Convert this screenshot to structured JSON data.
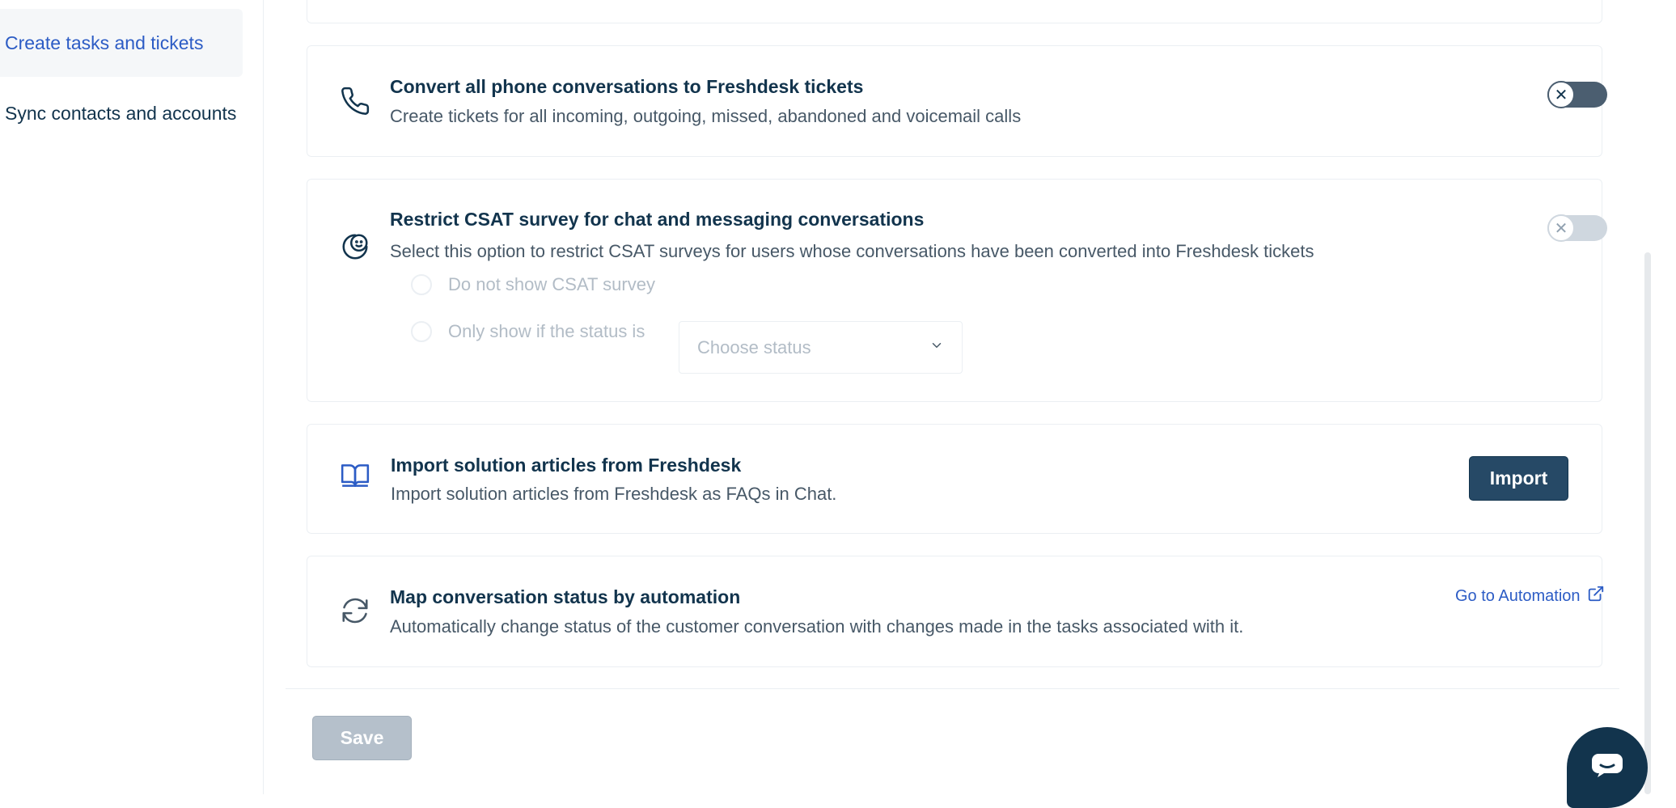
{
  "sidebar": {
    "items": [
      {
        "label": "Create tasks and tickets",
        "active": true
      },
      {
        "label": "Sync contacts and accounts",
        "active": false
      }
    ]
  },
  "settings": {
    "phone": {
      "title": "Convert all phone conversations to Freshdesk tickets",
      "description": "Create tickets for all incoming, outgoing, missed, abandoned and voicemail calls",
      "toggle_state": "off",
      "icon": "phone-icon"
    },
    "csat": {
      "title": "Restrict CSAT survey for chat and messaging conversations",
      "description": "Select this option to restrict CSAT surveys for users whose conversations have been converted into Freshdesk tickets",
      "toggle_state": "off-disabled",
      "icon": "smiley-icon",
      "options": [
        {
          "label": "Do not show CSAT survey"
        },
        {
          "label": "Only show if the status is"
        }
      ],
      "status_placeholder": "Choose status"
    },
    "import": {
      "title": "Import solution articles from Freshdesk",
      "description": "Import solution articles from Freshdesk as FAQs in Chat.",
      "button_label": "Import",
      "icon": "book-icon"
    },
    "map": {
      "title": "Map conversation status by automation",
      "description": "Automatically change status of the customer conversation with changes made in the tasks associated with it.",
      "link_label": "Go to Automation",
      "icon": "refresh-icon"
    }
  },
  "footer": {
    "save_label": "Save"
  },
  "colors": {
    "accent": "#2c5cc5",
    "primary_button": "#264966",
    "text": "#12344d",
    "muted": "#475867",
    "disabled": "#b2bcc6"
  }
}
